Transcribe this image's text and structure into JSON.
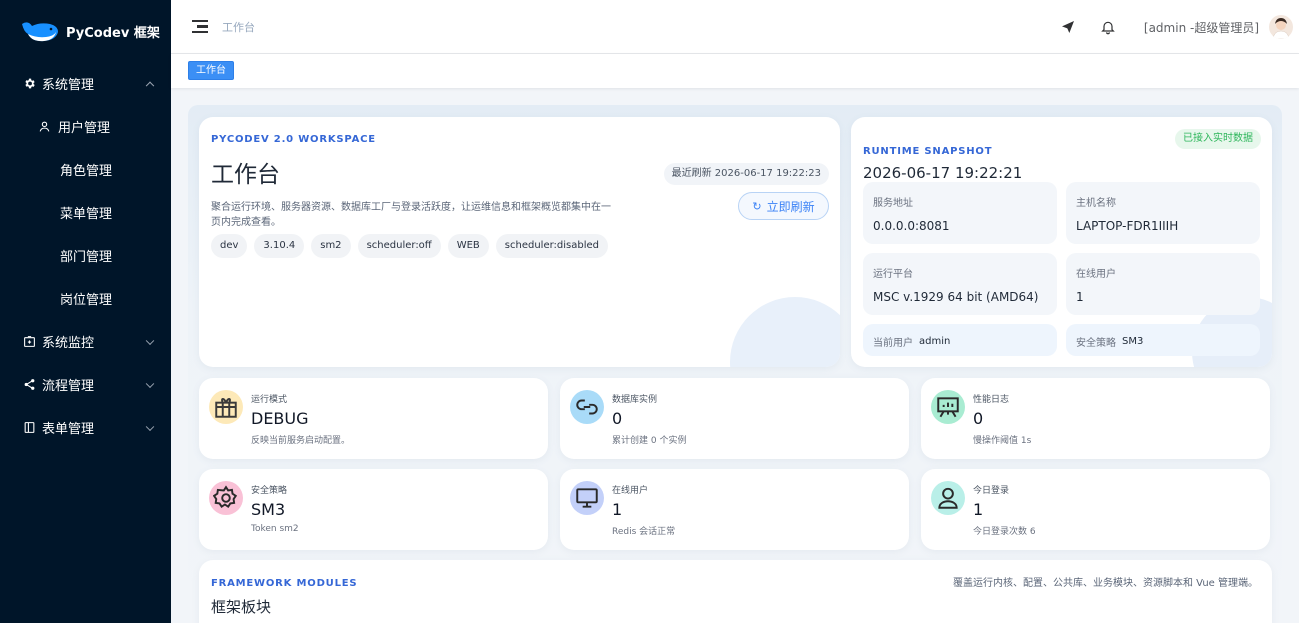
{
  "sidebar": {
    "logo_text": "PyCodev 框架",
    "menus": [
      {
        "label": "系统管理",
        "icon": "gear-icon",
        "expanded": true
      },
      {
        "label": "系统监控",
        "icon": "monitor-box-icon",
        "expanded": false
      },
      {
        "label": "流程管理",
        "icon": "share-icon",
        "expanded": false
      },
      {
        "label": "表单管理",
        "icon": "form-icon",
        "expanded": false
      }
    ],
    "sub_items": [
      "用户管理",
      "角色管理",
      "菜单管理",
      "部门管理",
      "岗位管理"
    ]
  },
  "header": {
    "breadcrumb": "工作台",
    "user_label": "[admin -超级管理员]"
  },
  "tags": {
    "active": "工作台"
  },
  "hero": {
    "eyebrow": "PYCODEV 2.0 WORKSPACE",
    "title": "工作台",
    "description": "聚合运行环境、服务器资源、数据库工厂与登录活跃度，让运维信息和框架概览都集中在一页内完成查看。",
    "refresh_time": "最近刷新 2026-06-17 19:22:23",
    "refresh_button": "立即刷新",
    "chips": [
      "dev",
      "3.10.4",
      "sm2",
      "scheduler:off",
      "WEB",
      "scheduler:disabled"
    ]
  },
  "runtime": {
    "eyebrow": "RUNTIME SNAPSHOT",
    "time": "2026-06-17 19:22:21",
    "badge": "已接入实时数据",
    "cells": [
      {
        "label": "服务地址",
        "value": "0.0.0.0:8081"
      },
      {
        "label": "主机名称",
        "value": "LAPTOP-FDR1IIIH"
      },
      {
        "label": "运行平台",
        "value": "MSC v.1929 64 bit (AMD64)"
      },
      {
        "label": "在线用户",
        "value": "1"
      }
    ],
    "current_user_label": "当前用户",
    "current_user_value": "admin",
    "security_label": "安全策略",
    "security_value": "SM3"
  },
  "stats": [
    {
      "label": "运行模式",
      "value": "DEBUG",
      "sub": "反映当前服务启动配置。",
      "icon": "gift-box-icon",
      "color": "#f6c343"
    },
    {
      "label": "数据库实例",
      "value": "0",
      "sub": "累计创建 0 个实例",
      "icon": "database-link-icon",
      "color": "#5ab8f2"
    },
    {
      "label": "性能日志",
      "value": "0",
      "sub": "慢操作阈值 1s",
      "icon": "presentation-chart-icon",
      "color": "#3ccf9a"
    },
    {
      "label": "安全策略",
      "value": "SM3",
      "sub": "Token sm2",
      "icon": "shield-gear-icon",
      "color": "#f07ba6"
    },
    {
      "label": "在线用户",
      "value": "1",
      "sub": "Redis 会话正常",
      "icon": "monitor-icon",
      "color": "#7c9cf5"
    },
    {
      "label": "今日登录",
      "value": "1",
      "sub": "今日登录次数 6",
      "icon": "user-icon",
      "color": "#6fdcd0"
    }
  ],
  "modules": {
    "eyebrow": "FRAMEWORK MODULES",
    "title": "框架板块",
    "description": "覆盖运行内核、配置、公共库、业务模块、资源脚本和 Vue 管理端。"
  }
}
